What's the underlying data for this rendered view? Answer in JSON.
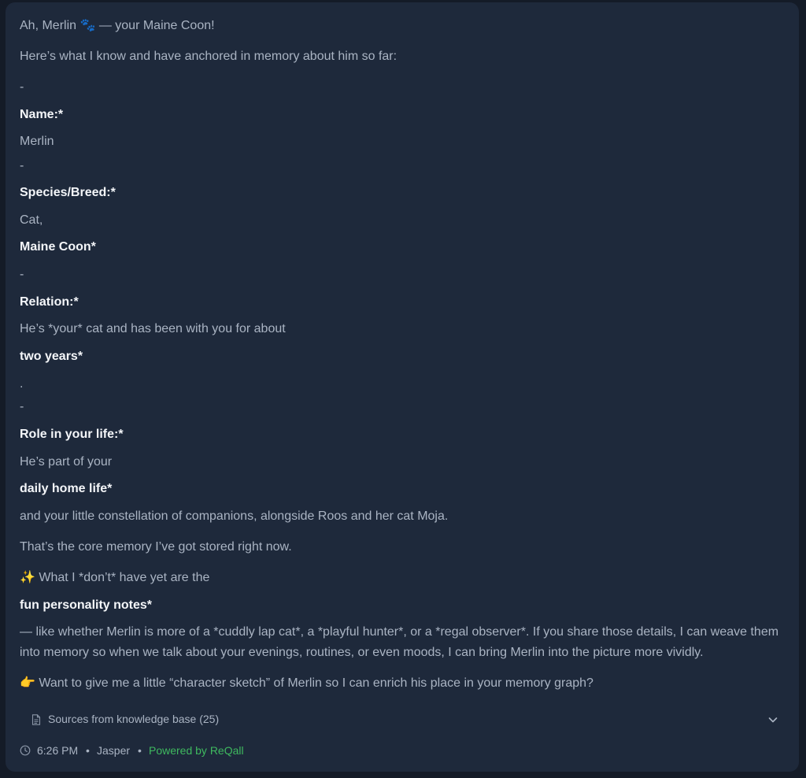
{
  "message": {
    "lines": [
      "Ah, Merlin 🐾 — your Maine Coon!",
      "Here’s what I know and have anchored in memory about him so far:",
      "-",
      "Name:*",
      "Merlin",
      "-",
      "Species/Breed:*",
      "Cat,",
      "Maine Coon*",
      "-",
      "Relation:*",
      "He’s *your* cat and has been with you for about",
      "two years*",
      ".",
      "-",
      "Role in your life:*",
      "He’s part of your",
      "daily home life*",
      "and your little constellation of companions, alongside Roos and her cat Moja.",
      "That’s the core memory I’ve got stored right now.",
      "✨ What I *don’t* have yet are the",
      "fun personality notes*",
      "— like whether Merlin is more of a *cuddly lap cat*, a *playful hunter*, or a *regal observer*. If you share those details, I can weave them into memory so when we talk about your evenings, routines, or even moods, I can bring Merlin into the picture more vividly.",
      "👉 Want to give me a little “character sketch” of Merlin so I can enrich his place in your memory graph?"
    ]
  },
  "sources": {
    "label": "Sources from knowledge base (25)",
    "icon": "document-icon",
    "toggle_icon": "chevron-down-icon"
  },
  "meta": {
    "time": "6:26 PM",
    "separator": "•",
    "agent": "Jasper",
    "powered_by": "Powered by ReQall",
    "powered_color": "#3fb95f"
  },
  "colors": {
    "background": "#141b27",
    "card": "#1e293b",
    "text_muted": "#aab4c3",
    "text_bold": "#f4f6f9"
  }
}
